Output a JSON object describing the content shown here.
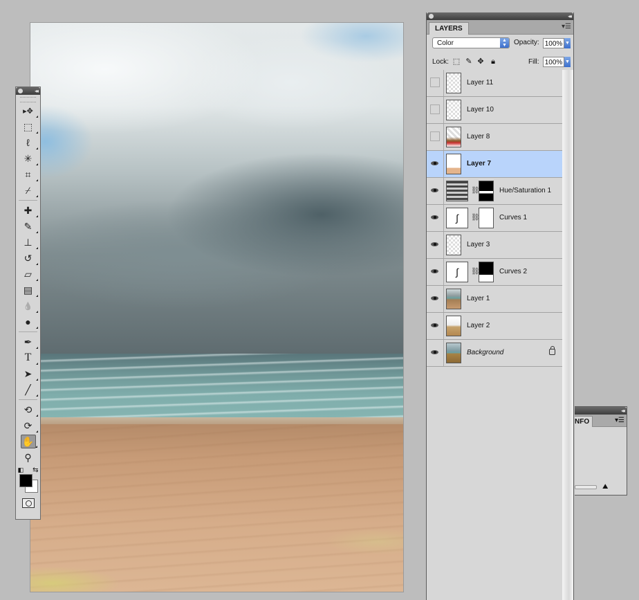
{
  "tools": [
    {
      "name": "move-tool-icon",
      "glyph": "▸✥"
    },
    {
      "name": "marquee-tool-icon",
      "glyph": "⬚"
    },
    {
      "name": "lasso-tool-icon",
      "glyph": "ℓ"
    },
    {
      "name": "magic-wand-tool-icon",
      "glyph": "✳"
    },
    {
      "name": "crop-tool-icon",
      "glyph": "⌗"
    },
    {
      "name": "eyedropper-tool-icon",
      "glyph": "⌿"
    },
    {
      "name": "healing-brush-tool-icon",
      "glyph": "✚"
    },
    {
      "name": "brush-tool-icon",
      "glyph": "✎"
    },
    {
      "name": "clone-stamp-tool-icon",
      "glyph": "⊥"
    },
    {
      "name": "history-brush-tool-icon",
      "glyph": "↺"
    },
    {
      "name": "eraser-tool-icon",
      "glyph": "▱"
    },
    {
      "name": "gradient-tool-icon",
      "glyph": "▤"
    },
    {
      "name": "blur-tool-icon",
      "glyph": "💧"
    },
    {
      "name": "dodge-tool-icon",
      "glyph": "●"
    },
    {
      "name": "pen-tool-icon",
      "glyph": "✒"
    },
    {
      "name": "type-tool-icon",
      "glyph": "T"
    },
    {
      "name": "path-selection-tool-icon",
      "glyph": "➤"
    },
    {
      "name": "line-tool-icon",
      "glyph": "╱"
    },
    {
      "name": "3d-rotate-tool-icon",
      "glyph": "⟲"
    },
    {
      "name": "3d-orbit-tool-icon",
      "glyph": "⟳"
    },
    {
      "name": "hand-tool-icon",
      "glyph": "✋"
    },
    {
      "name": "zoom-tool-icon",
      "glyph": "⚲"
    }
  ],
  "layers_panel": {
    "tab": "LAYERS",
    "blend_mode": "Color",
    "opacity_label": "Opacity:",
    "opacity": "100%",
    "lock_label": "Lock:",
    "fill_label": "Fill:",
    "fill": "100%",
    "layers": [
      {
        "name": "Layer 11",
        "visible": false,
        "selected": false
      },
      {
        "name": "Layer 10",
        "visible": false,
        "selected": false
      },
      {
        "name": "Layer 8",
        "visible": false,
        "selected": false
      },
      {
        "name": "Layer 7",
        "visible": true,
        "selected": true
      },
      {
        "name": "Hue/Saturation 1",
        "visible": true,
        "selected": false
      },
      {
        "name": "Curves 1",
        "visible": true,
        "selected": false
      },
      {
        "name": "Layer 3",
        "visible": true,
        "selected": false
      },
      {
        "name": "Curves 2",
        "visible": true,
        "selected": false
      },
      {
        "name": "Layer 1",
        "visible": true,
        "selected": false
      },
      {
        "name": "Layer 2",
        "visible": true,
        "selected": false
      },
      {
        "name": "Background",
        "visible": true,
        "selected": false,
        "locked": true
      }
    ]
  },
  "info_panel": {
    "tab": "NFO"
  },
  "colors": {
    "foreground": "#000000",
    "background": "#ffffff",
    "selection": "#b9d4fb"
  }
}
